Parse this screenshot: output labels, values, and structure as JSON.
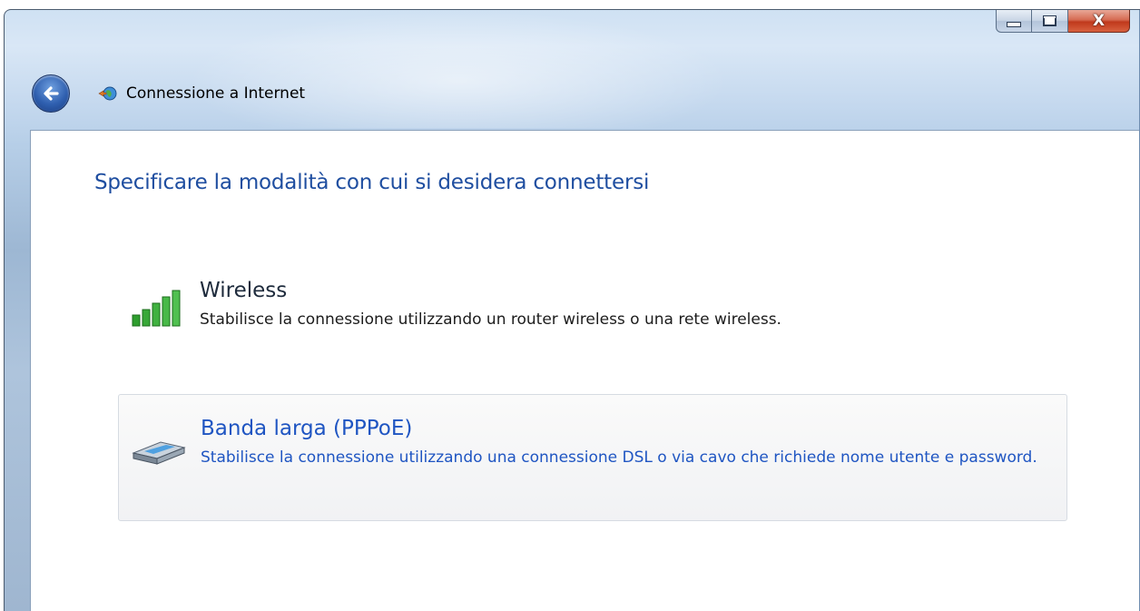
{
  "window": {
    "title": "Connessione a Internet",
    "caption_buttons": {
      "minimize": "–",
      "maximize": "□",
      "close": "X"
    }
  },
  "main": {
    "heading": "Specificare la modalità con cui si desidera connettersi",
    "options": [
      {
        "title": "Wireless",
        "description": "Stabilisce la connessione utilizzando un router wireless o una rete wireless.",
        "icon": "wireless-signal-icon"
      },
      {
        "title": "Banda larga (PPPoE)",
        "description": "Stabilisce la connessione utilizzando una connessione DSL o via cavo che richiede nome utente e password.",
        "icon": "broadband-modem-icon",
        "selected_hover": true
      }
    ]
  },
  "colors": {
    "heading": "#1f4ea0",
    "link_blue": "#1f55c2",
    "close_red": "#c0391c"
  }
}
